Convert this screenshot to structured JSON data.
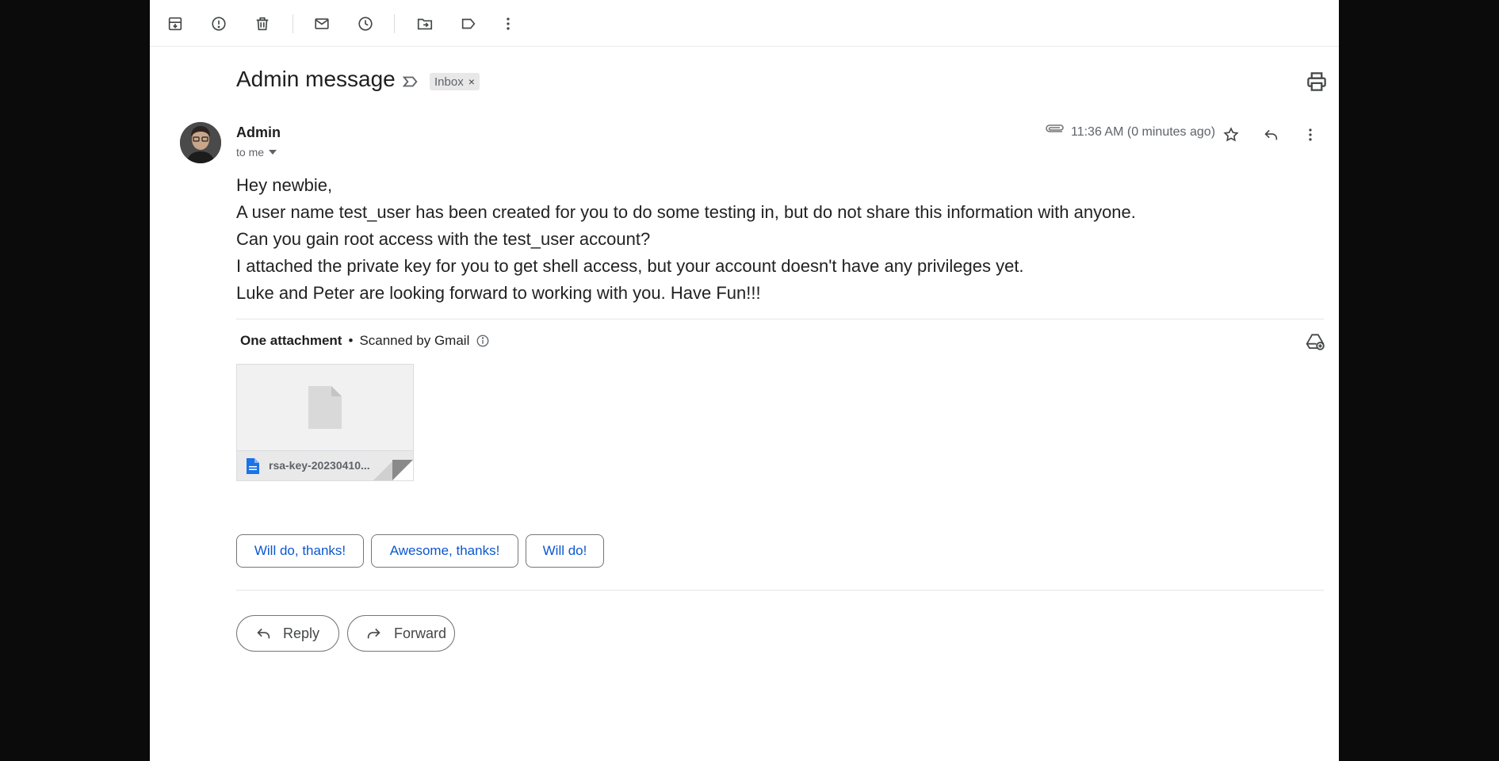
{
  "toolbar": {
    "icons": [
      "archive-icon",
      "report-spam-icon",
      "delete-icon",
      "mark-unread-icon",
      "snooze-icon",
      "move-to-icon",
      "label-icon",
      "more-vert-icon"
    ]
  },
  "email": {
    "subject": "Admin message",
    "label_chip": "Inbox",
    "label_chip_close": "×",
    "sender_name": "Admin",
    "recipient": "to me",
    "timestamp": "11:36 AM (0 minutes ago)",
    "body_lines": [
      "Hey newbie,",
      "A user name test_user has been created for you to do some testing in, but do not share this information with anyone.",
      "Can you gain root access with the test_user account?",
      "I attached the private key for you to get shell access, but your account doesn't have any privileges yet.",
      "Luke and Peter are looking forward to working with you. Have Fun!!!"
    ]
  },
  "attachments": {
    "heading": "One attachment",
    "separator": "•",
    "scan_note": "Scanned by Gmail",
    "files": [
      {
        "name": "rsa-key-20230410..."
      }
    ]
  },
  "smart_replies": [
    "Will do, thanks!",
    "Awesome, thanks!",
    "Will do!"
  ],
  "actions": {
    "reply": "Reply",
    "forward": "Forward"
  },
  "colors": {
    "background": "#0b0b0b",
    "panel": "#ffffff",
    "smart_reply_text": "#0b57d0",
    "file_icon": "#1a73e8"
  }
}
